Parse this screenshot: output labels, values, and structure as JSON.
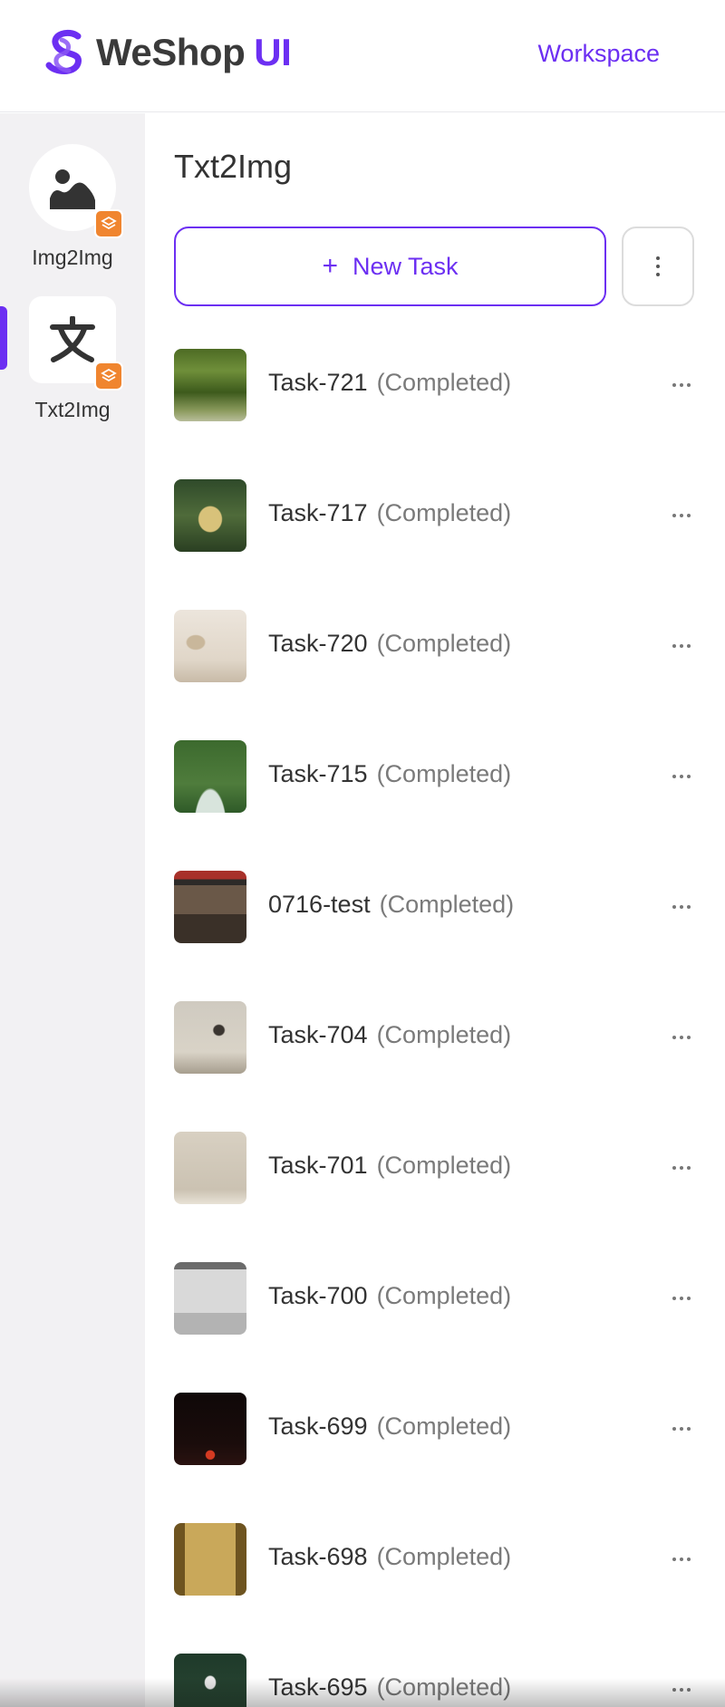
{
  "header": {
    "brand_name": "WeShop",
    "brand_suffix": "UI",
    "workspace_label": "Workspace",
    "accent_color": "#6c2ff2"
  },
  "sidebar": {
    "items": [
      {
        "label": "Img2Img",
        "icon": "landscape-image-icon",
        "badge_icon": "layers-icon",
        "active": false
      },
      {
        "label": "Txt2Img",
        "icon": "text-glyph-icon",
        "badge_icon": "layers-icon",
        "active": true
      }
    ],
    "badge_color": "#f0852f"
  },
  "main": {
    "title": "Txt2Img",
    "new_task_label": "New Task",
    "new_task_icon": "plus-icon",
    "more_icon": "vertical-dots-icon"
  },
  "tasks": [
    {
      "name": "Task-721",
      "status": "(Completed)"
    },
    {
      "name": "Task-717",
      "status": "(Completed)"
    },
    {
      "name": "Task-720",
      "status": "(Completed)"
    },
    {
      "name": "Task-715",
      "status": "(Completed)"
    },
    {
      "name": "0716-test",
      "status": "(Completed)"
    },
    {
      "name": "Task-704",
      "status": "(Completed)"
    },
    {
      "name": "Task-701",
      "status": "(Completed)"
    },
    {
      "name": "Task-700",
      "status": "(Completed)"
    },
    {
      "name": "Task-699",
      "status": "(Completed)"
    },
    {
      "name": "Task-698",
      "status": "(Completed)"
    },
    {
      "name": "Task-695",
      "status": "(Completed)"
    }
  ]
}
